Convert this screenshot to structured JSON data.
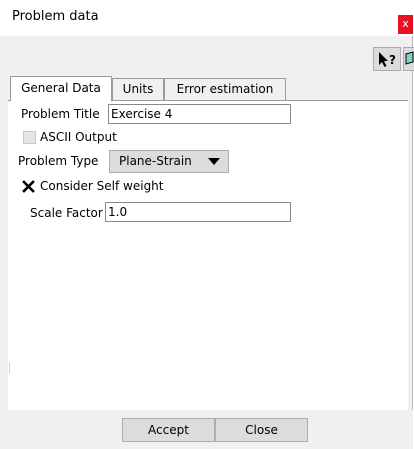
{
  "window": {
    "title": "Problem data",
    "close_glyph": "x"
  },
  "toolbar": {
    "help_icon": "whats-this-help-icon",
    "book_icon": "book-dropdown-icon"
  },
  "tabs": [
    {
      "label": "General Data",
      "active": true
    },
    {
      "label": "Units",
      "active": false
    },
    {
      "label": "Error estimation",
      "active": false
    }
  ],
  "general": {
    "problem_title_label": "Problem Title",
    "problem_title_value": "Exercise 4",
    "ascii_output_label": "ASCII Output",
    "ascii_output_checked": false,
    "ascii_output_enabled": false,
    "problem_type_label": "Problem Type",
    "problem_type_value": "Plane-Strain",
    "self_weight_label": "Consider Self weight",
    "self_weight_checked": true,
    "scale_factor_label": "Scale Factor",
    "scale_factor_value": "1.0"
  },
  "footer": {
    "accept_label": "Accept",
    "close_label": "Close"
  },
  "colors": {
    "close_button": "#e81123",
    "dialog_bg": "#f0f0f0",
    "panel_bg": "#ffffff"
  }
}
